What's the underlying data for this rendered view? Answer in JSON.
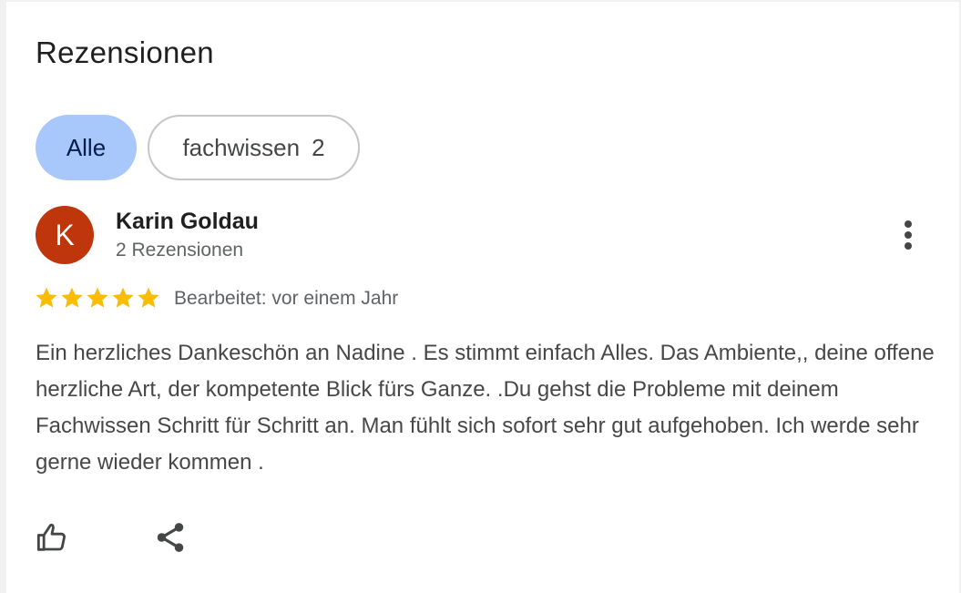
{
  "reviews_section": {
    "heading": "Rezensionen",
    "filters": [
      {
        "label": "Alle",
        "selected": true
      },
      {
        "label": "fachwissen",
        "count": "2",
        "selected": false
      }
    ],
    "review": {
      "avatar_initial": "K",
      "avatar_color": "#c0360c",
      "author_name": "Karin Goldau",
      "author_review_count": "2 Rezensionen",
      "rating": 5,
      "rating_max": 5,
      "edited_label": "Bearbeitet: vor einem Jahr",
      "text": "Ein herzliches Dankeschön an Nadine . Es stimmt einfach Alles. Das Ambiente,, deine offene herzliche Art, der kompetente Blick fürs Ganze. .Du gehst die Probleme mit deinem Fachwissen Schritt für Schritt an. Man fühlt sich sofort sehr gut aufgehoben. Ich werde sehr gerne wieder kommen .",
      "actions": [
        "thumb-up-icon",
        "share-icon"
      ],
      "menu_icon": "more-vert-icon"
    }
  },
  "colors": {
    "selected_chip": "#a8c7fa",
    "star": "#fbbc04",
    "avatar": "#c0360c"
  }
}
